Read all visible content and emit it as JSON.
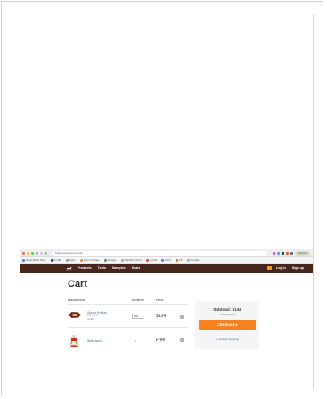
{
  "browser": {
    "url": "lvillaturonjerky.com/cart",
    "resume_label": "Resume",
    "bookmarks": [
      "Good Bank Sites",
      "Kindle",
      "Apps",
      "Spent Unique",
      "Google",
      "Quickfix Admin",
      "Gmail",
      "Docs",
      "Fb",
      "Moodle"
    ]
  },
  "site_nav": {
    "links": [
      "Products",
      "Tools",
      "Samples",
      "Deals"
    ],
    "login": "Log in",
    "signup": "Sign up"
  },
  "cart": {
    "title": "Cart",
    "columns": {
      "description": "DESCRIPTION",
      "quantity": "QUANTITY",
      "total": "TOTAL"
    },
    "items": [
      {
        "name": "Smoky Brisket",
        "meta_line1": "1.5 x 1.2",
        "meta_line2": "Gifted",
        "quantity": "100",
        "total": "$134",
        "remove": "⊗"
      },
      {
        "name": "Wafa sauce",
        "quantity": "1",
        "total": "Free",
        "remove": "⊗"
      }
    ]
  },
  "summary": {
    "subtotal": "Subtotal: $134",
    "shipping": "Free shipping",
    "checkout_label": "Checkout ▸",
    "continue_label": "or continue shopping"
  },
  "colors": {
    "nav_bg": "#47271c",
    "accent": "#f5821f",
    "link": "#2e6fa8"
  }
}
